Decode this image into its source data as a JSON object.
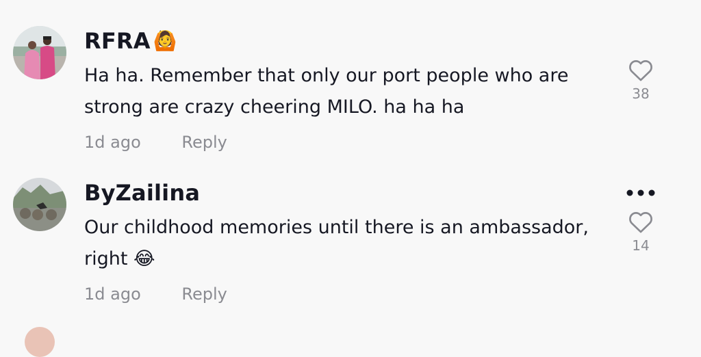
{
  "comments": [
    {
      "username": "RFRA",
      "username_emoji": "🙆",
      "text": "Ha ha. Remember that only our port people who are strong are crazy cheering MILO. ha ha ha",
      "time": "1d ago",
      "reply_label": "Reply",
      "like_count": "38",
      "like_icon": "heart-outline-icon"
    },
    {
      "username": "ByZailina",
      "text": "Our childhood memories until there is an ambassador, right 😂",
      "time": "1d ago",
      "reply_label": "Reply",
      "like_count": "14",
      "like_icon": "heart-outline-icon",
      "more_icon": "more-options-icon"
    }
  ],
  "colors": {
    "background": "#f8f8f8",
    "primary_text": "#161823",
    "secondary_text": "#8a8b91"
  }
}
